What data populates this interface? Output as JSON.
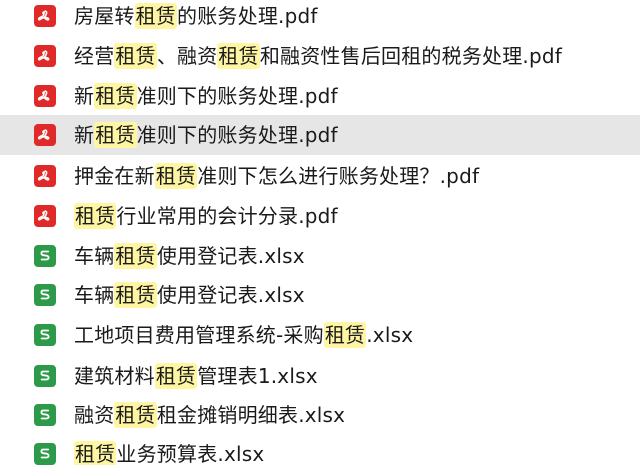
{
  "files": [
    {
      "type": "pdf",
      "name": "房屋转租赁的账务处理.pdf",
      "selected": false
    },
    {
      "type": "pdf",
      "name": "经营租赁、融资租赁和融资性售后回租的税务处理.pdf",
      "selected": false
    },
    {
      "type": "pdf",
      "name": "新租赁准则下的账务处理.pdf",
      "selected": false
    },
    {
      "type": "pdf",
      "name": "新租赁准则下的账务处理.pdf",
      "selected": true
    },
    {
      "type": "pdf",
      "name": "押金在新租赁准则下怎么进行账务处理？.pdf",
      "selected": false
    },
    {
      "type": "pdf",
      "name": "租赁行业常用的会计分录.pdf",
      "selected": false
    },
    {
      "type": "xlsx",
      "name": "车辆租赁使用登记表.xlsx",
      "selected": false
    },
    {
      "type": "xlsx",
      "name": "车辆租赁使用登记表.xlsx",
      "selected": false
    },
    {
      "type": "xlsx",
      "name": "工地项目费用管理系统-采购租赁.xlsx",
      "selected": false
    },
    {
      "type": "xlsx",
      "name": "建筑材料租赁管理表1.xlsx",
      "selected": false
    },
    {
      "type": "xlsx",
      "name": "融资租赁租金摊销明细表.xlsx",
      "selected": false
    },
    {
      "type": "xlsx",
      "name": "租赁业务预算表.xlsx",
      "selected": false
    }
  ],
  "highlight_term": "租赁",
  "colors": {
    "pdf_icon": "#e02a2a",
    "xlsx_icon": "#2c9a48",
    "highlight": "#fff6a3",
    "selected_row": "#e6e6e6"
  },
  "icons": {
    "pdf": "pdf-file-icon",
    "xlsx": "spreadsheet-file-icon"
  }
}
